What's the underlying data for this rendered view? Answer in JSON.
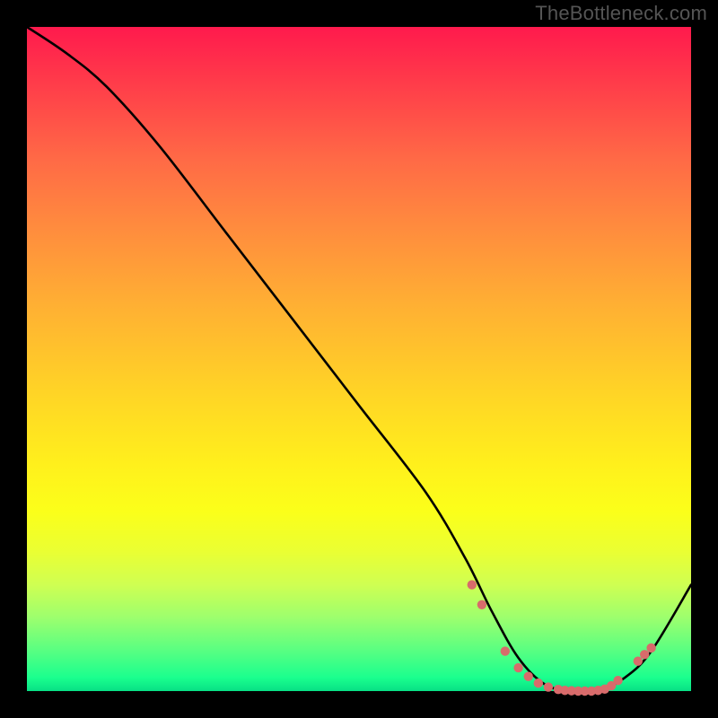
{
  "attribution": "TheBottleneck.com",
  "chart_data": {
    "type": "line",
    "title": "",
    "xlabel": "",
    "ylabel": "",
    "xlim": [
      0,
      100
    ],
    "ylim": [
      0,
      100
    ],
    "series": [
      {
        "name": "bottleneck-curve",
        "x": [
          0,
          6,
          12,
          20,
          30,
          40,
          50,
          60,
          66,
          70,
          74,
          78,
          82,
          86,
          90,
          94,
          100
        ],
        "y": [
          100,
          96,
          91,
          82,
          69,
          56,
          43,
          30,
          20,
          12,
          5,
          1,
          0,
          0,
          2,
          6,
          16
        ]
      }
    ],
    "markers": {
      "name": "trough-dots",
      "color": "#d86b6b",
      "x": [
        67,
        68.5,
        72,
        74,
        75.5,
        77,
        78.5,
        80,
        81,
        82,
        83,
        84,
        85,
        86,
        87,
        88,
        89,
        92,
        93,
        94
      ],
      "y": [
        16,
        13,
        6,
        3.5,
        2.2,
        1.2,
        0.6,
        0.25,
        0.1,
        0.05,
        0,
        0,
        0,
        0.1,
        0.3,
        0.8,
        1.6,
        4.5,
        5.5,
        6.5
      ]
    },
    "gradient_stops": [
      {
        "pos": 0.0,
        "color": "#ff1a4d"
      },
      {
        "pos": 0.3,
        "color": "#ff8b3e"
      },
      {
        "pos": 0.66,
        "color": "#fff01c"
      },
      {
        "pos": 1.0,
        "color": "#08e085"
      }
    ]
  }
}
